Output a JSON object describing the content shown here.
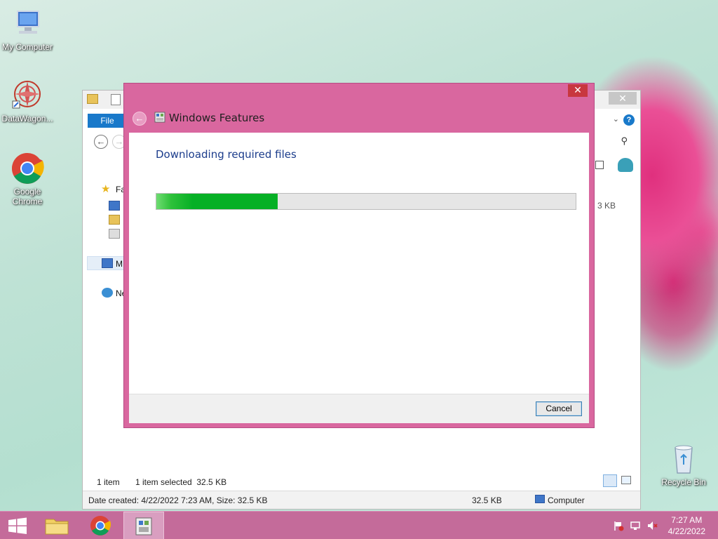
{
  "desktop": {
    "icons": [
      {
        "label": "My Computer"
      },
      {
        "label": "DataWagon..."
      },
      {
        "label": "Google Chrome"
      },
      {
        "label": "Recycle Bin"
      }
    ]
  },
  "explorer": {
    "ribbon_tab": "File",
    "sidebar_partial": [
      "Fa",
      "M",
      "Ne"
    ],
    "size_partial": "3 KB",
    "item_count": "1 item",
    "selection": "1 item selected  32.5 KB",
    "status_details": "Date created: 4/22/2022 7:23 AM, Size: 32.5 KB",
    "status_size": "32.5 KB",
    "status_location": "Computer",
    "close_glyph": "✕"
  },
  "dialog": {
    "title": "Windows Features",
    "heading": "Downloading required files",
    "progress": 0.29,
    "cancel_label": "Cancel",
    "close_glyph": "✕",
    "back_glyph": "←"
  },
  "taskbar": {
    "time": "7:27 AM",
    "date": "4/22/2022"
  },
  "colors": {
    "dialog_frame": "#d9679f",
    "taskbar": "#c46b9a",
    "progress_fill": "#06b025",
    "ribbon_blue": "#1979ca"
  }
}
